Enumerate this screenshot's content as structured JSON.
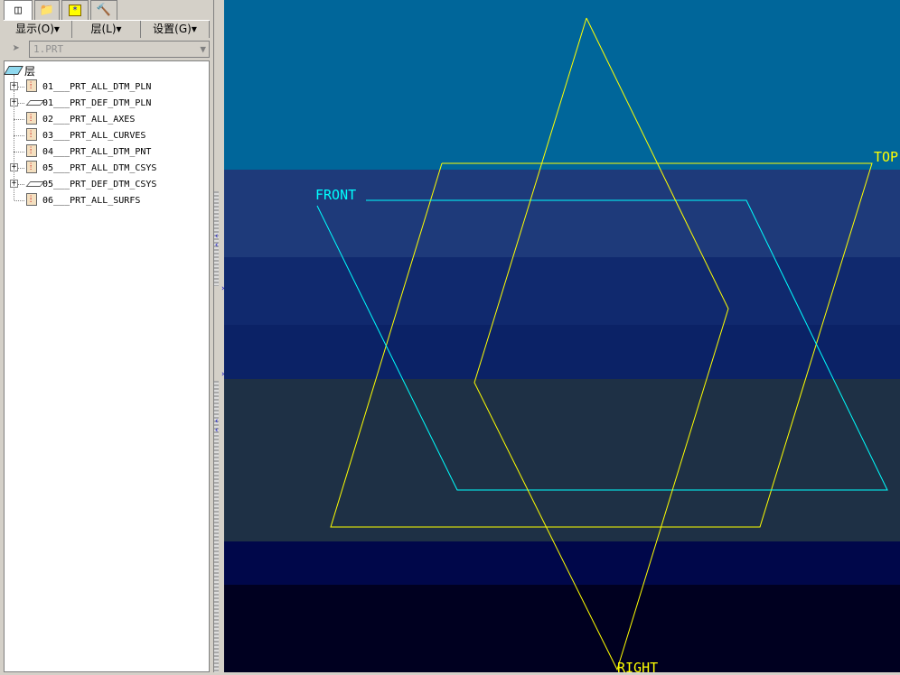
{
  "tabs": [
    {
      "icon": "model-tree-icon"
    },
    {
      "icon": "folder-browser-icon"
    },
    {
      "icon": "favorites-icon"
    },
    {
      "icon": "connections-icon"
    }
  ],
  "menus": [
    {
      "label": "显示(O)▾"
    },
    {
      "label": "层(L)▾"
    },
    {
      "label": "设置(G)▾"
    }
  ],
  "selector": {
    "value": "1.PRT"
  },
  "tree": {
    "root": "层",
    "items": [
      {
        "label": "01___PRT_ALL_DTM_PLN",
        "expandable": true,
        "icon": "layer-icon"
      },
      {
        "label": "01___PRT_DEF_DTM_PLN",
        "expandable": true,
        "icon": "plane-icon"
      },
      {
        "label": "02___PRT_ALL_AXES",
        "expandable": false,
        "icon": "layer-icon"
      },
      {
        "label": "03___PRT_ALL_CURVES",
        "expandable": false,
        "icon": "layer-icon"
      },
      {
        "label": "04___PRT_ALL_DTM_PNT",
        "expandable": false,
        "icon": "layer-icon"
      },
      {
        "label": "05___PRT_ALL_DTM_CSYS",
        "expandable": true,
        "icon": "layer-icon"
      },
      {
        "label": "05___PRT_DEF_DTM_CSYS",
        "expandable": true,
        "icon": "plane-icon"
      },
      {
        "label": "06___PRT_ALL_SURFS",
        "expandable": false,
        "icon": "layer-icon"
      }
    ]
  },
  "viewport": {
    "planes": [
      {
        "label": "TOP",
        "color": "#ffff00"
      },
      {
        "label": "FRONT",
        "color": "#00ffff"
      },
      {
        "label": "RIGHT",
        "color": "#ffff00"
      }
    ]
  }
}
